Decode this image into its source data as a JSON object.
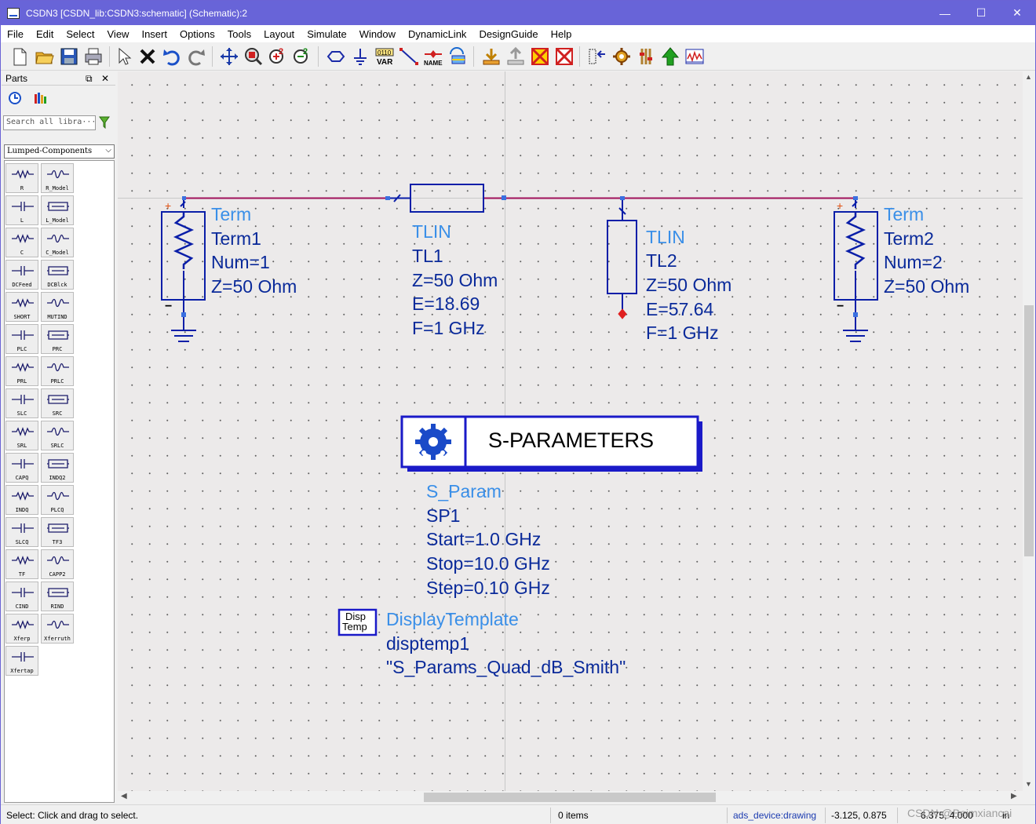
{
  "window": {
    "title": "CSDN3 [CSDN_lib:CSDN3:schematic] (Schematic):2",
    "controls": {
      "minimize": "—",
      "maximize": "☐",
      "close": "✕"
    }
  },
  "menu": [
    "File",
    "Edit",
    "Select",
    "View",
    "Insert",
    "Options",
    "Tools",
    "Layout",
    "Simulate",
    "Window",
    "DynamicLink",
    "DesignGuide",
    "Help"
  ],
  "toolbar": {
    "var_label": "VAR",
    "var_bits": "0110",
    "name_label": "NAME"
  },
  "parts_panel": {
    "title": "Parts",
    "search_placeholder": "Search all libra···",
    "library": "Lumped-Components",
    "components": [
      "R",
      "R_Model",
      "L",
      "L_Model",
      "C",
      "C_Model",
      "DCFeed",
      "DCBlck",
      "SHORT",
      "MUTIND",
      "PLC",
      "PRC",
      "PRL",
      "PRLC",
      "SLC",
      "SRC",
      "SRL",
      "SRLC",
      "CAPQ",
      "INDQ2",
      "INDQ",
      "PLCQ",
      "SLCQ",
      "TF3",
      "TF",
      "CAPP2",
      "CIND",
      "RIND",
      "Xferp",
      "Xferruth",
      "Xfertap"
    ]
  },
  "schematic": {
    "term1": {
      "type": "Term",
      "name": "Term1",
      "num": "Num=1",
      "z": "Z=50 Ohm"
    },
    "tl1": {
      "type": "TLIN",
      "name": "TL1",
      "z": "Z=50 Ohm",
      "e": "E=18.69",
      "f": "F=1 GHz"
    },
    "tl2": {
      "type": "TLIN",
      "name": "TL2",
      "z": "Z=50 Ohm",
      "e": "E=57.64",
      "f": "F=1 GHz"
    },
    "term2": {
      "type": "Term",
      "name": "Term2",
      "num": "Num=2",
      "z": "Z=50 Ohm"
    },
    "sparam": {
      "box_title": "S-PARAMETERS",
      "type": "S_Param",
      "name": "SP1",
      "start": "Start=1.0 GHz",
      "stop": "Stop=10.0 GHz",
      "step": "Step=0.10 GHz"
    },
    "disp": {
      "icon_line1": "Disp",
      "icon_line2": "Temp",
      "type": "DisplayTemplate",
      "name": "disptemp1",
      "value": "\"S_Params_Quad_dB_Smith\""
    },
    "plus_sign": "+",
    "minus_sign": "−"
  },
  "status": {
    "message": "Select: Click and drag to select.",
    "items": "0 items",
    "layer": "ads_device:drawing",
    "coords": "-3.125, 0.875",
    "coords2": "6.375, 4.000",
    "units": "in",
    "watermark": "CSDN @Beimxiancai"
  },
  "colors": {
    "titlebar": "#6864d8",
    "wire": "#a0105a",
    "component": "#0a1ea8",
    "label_type": "#3a8fe8",
    "label_value": "#0a2a9a"
  }
}
